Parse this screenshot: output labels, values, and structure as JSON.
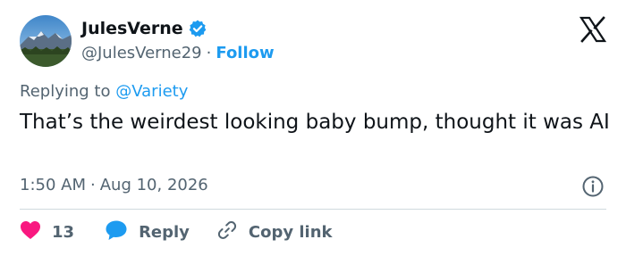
{
  "author": {
    "display_name": "JulesVerne",
    "handle": "@JulesVerne29",
    "separator": "·",
    "follow_label": "Follow",
    "verified_color": "#1d9bf0"
  },
  "reply_context": {
    "prefix": "Replying to",
    "mention": "@Variety"
  },
  "tweet": {
    "text": "That’s the weirdest looking baby bump, thought it was AI"
  },
  "meta": {
    "time": "1:50 AM",
    "separator": "·",
    "date": "Aug 10, 2026"
  },
  "actions": {
    "like_count": "13",
    "reply_label": "Reply",
    "copy_link_label": "Copy link"
  },
  "colors": {
    "accent": "#1d9bf0",
    "like": "#f91880",
    "text": "#0f1419",
    "muted": "#536471"
  },
  "icons": [
    "avatar-mountain-landscape",
    "verified-badge-icon",
    "x-logo-icon",
    "info-icon",
    "heart-icon",
    "reply-bubble-icon",
    "link-icon"
  ]
}
